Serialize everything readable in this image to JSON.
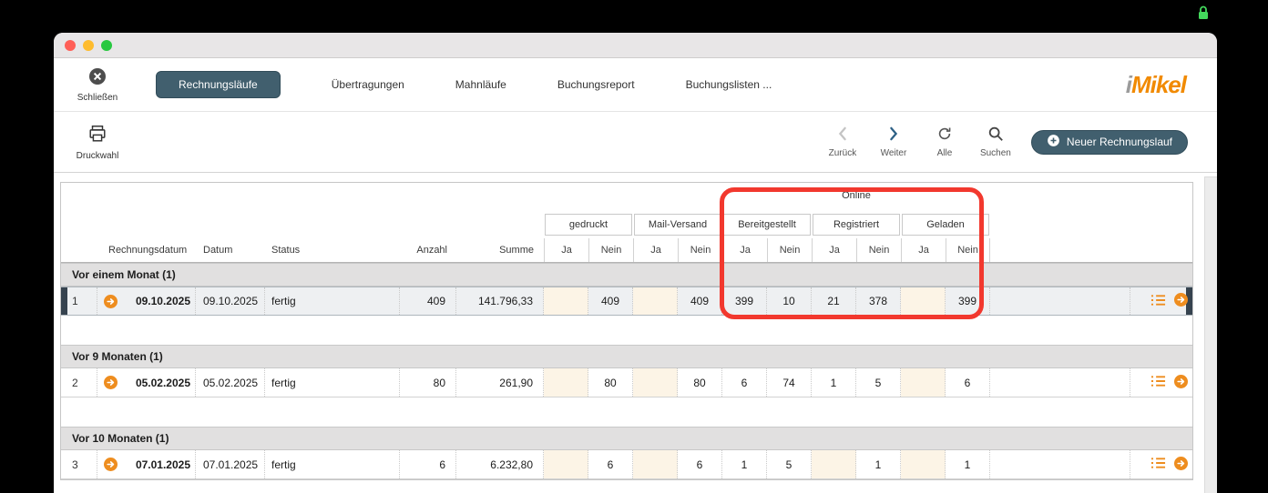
{
  "window": {
    "traffic_lights": [
      "close",
      "minimize",
      "zoom"
    ],
    "lock_icon": "green-lock"
  },
  "toolbar": {
    "close_label": "Schließen",
    "tabs": [
      {
        "label": "Rechnungsläufe",
        "active": true
      },
      {
        "label": "Übertragungen",
        "active": false
      },
      {
        "label": "Mahnläufe",
        "active": false
      },
      {
        "label": "Buchungsreport",
        "active": false
      },
      {
        "label": "Buchungslisten ...",
        "active": false
      }
    ],
    "logo": {
      "i": "i",
      "rest": "Mikel"
    }
  },
  "actionbar": {
    "print_label": "Druckwahl",
    "back_label": "Zurück",
    "forward_label": "Weiter",
    "all_label": "Alle",
    "search_label": "Suchen",
    "new_run_label": "Neuer Rechnungslauf"
  },
  "table": {
    "online_label": "Online",
    "groups": [
      "gedruckt",
      "Mail-Versand",
      "Bereitgestellt",
      "Registriert",
      "Geladen"
    ],
    "yn": {
      "ja": "Ja",
      "nein": "Nein"
    },
    "columns": {
      "rechnungsdatum": "Rechnungsdatum",
      "datum": "Datum",
      "status": "Status",
      "anzahl": "Anzahl",
      "summe": "Summe"
    },
    "sections": [
      {
        "title": "Vor einem Monat (1)",
        "rows": [
          {
            "num": "1",
            "rechnungsdatum": "09.10.2025",
            "datum": "09.10.2025",
            "status": "fertig",
            "anzahl": "409",
            "summe": "141.796,33",
            "cells": [
              "",
              "409",
              "",
              "409",
              "399",
              "10",
              "21",
              "378",
              "",
              "399"
            ],
            "selected": true
          }
        ]
      },
      {
        "title": "Vor 9 Monaten (1)",
        "rows": [
          {
            "num": "2",
            "rechnungsdatum": "05.02.2025",
            "datum": "05.02.2025",
            "status": "fertig",
            "anzahl": "80",
            "summe": "261,90",
            "cells": [
              "",
              "80",
              "",
              "80",
              "6",
              "74",
              "1",
              "5",
              "",
              "6"
            ],
            "selected": false
          }
        ]
      },
      {
        "title": "Vor 10 Monaten (1)",
        "rows": [
          {
            "num": "3",
            "rechnungsdatum": "07.01.2025",
            "datum": "07.01.2025",
            "status": "fertig",
            "anzahl": "6",
            "summe": "6.232,80",
            "cells": [
              "",
              "6",
              "",
              "6",
              "1",
              "5",
              "",
              "1",
              "",
              "1"
            ],
            "selected": false
          }
        ]
      }
    ]
  },
  "annotation": {
    "type": "red-highlight-box",
    "around": "Online Bereitgestellt/Registriert/Geladen columns"
  },
  "icons": {
    "close": "circle-x",
    "print": "printer",
    "back": "chevron-left",
    "forward": "chevron-right",
    "refresh": "circular-arrows",
    "search": "magnifier",
    "add": "plus-circle",
    "row_open": "orange-circle-arrow",
    "row_list": "orange-list",
    "lock": "green-padlock"
  },
  "colors": {
    "accent_orange": "#EE8D1F",
    "slate": "#415F6E",
    "highlight_red": "#F2382E",
    "cream_cell": "#FCF4E6"
  }
}
